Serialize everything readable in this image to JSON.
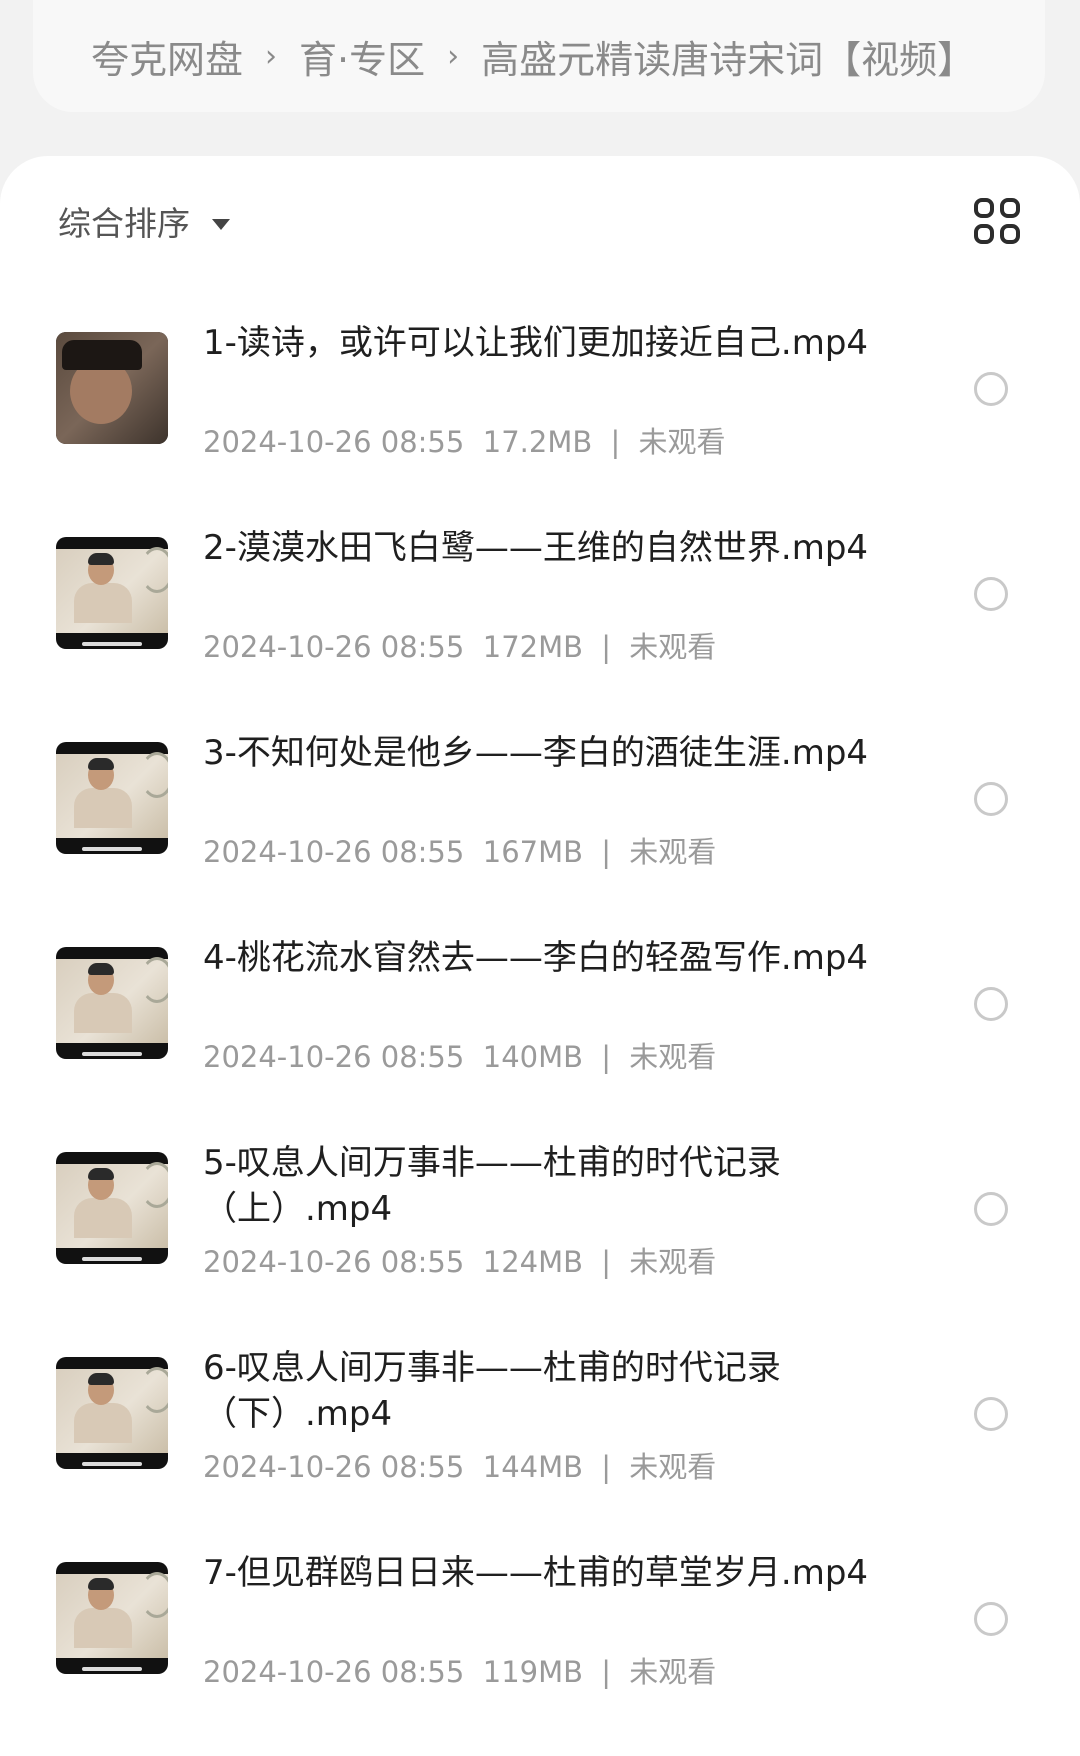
{
  "breadcrumb": {
    "items": [
      "夸克网盘",
      "育·专区",
      "高盛元精读唐诗宋词【视频】"
    ],
    "separator": "›"
  },
  "toolbar": {
    "sort_label": "综合排序",
    "sort_icon": "caret-down-icon",
    "view_icon": "grid-view-icon"
  },
  "files": [
    {
      "name": "1-读诗，或许可以让我们更加接近自己.mp4",
      "date": "2024-10-26 08:55",
      "size": "17.2MB",
      "sep": "|",
      "status": "未观看"
    },
    {
      "name": "2-漠漠水田飞白鹭——王维的自然世界.mp4",
      "date": "2024-10-26 08:55",
      "size": "172MB",
      "sep": "|",
      "status": "未观看"
    },
    {
      "name": "3-不知何处是他乡——李白的酒徒生涯.mp4",
      "date": "2024-10-26 08:55",
      "size": "167MB",
      "sep": "|",
      "status": "未观看"
    },
    {
      "name": "4-桃花流水窅然去——李白的轻盈写作.mp4",
      "date": "2024-10-26 08:55",
      "size": "140MB",
      "sep": "|",
      "status": "未观看"
    },
    {
      "name": "5-叹息人间万事非——杜甫的时代记录（上）.mp4",
      "date": "2024-10-26 08:55",
      "size": "124MB",
      "sep": "|",
      "status": "未观看"
    },
    {
      "name": "6-叹息人间万事非——杜甫的时代记录（下）.mp4",
      "date": "2024-10-26 08:55",
      "size": "144MB",
      "sep": "|",
      "status": "未观看"
    },
    {
      "name": "7-但见群鸥日日来——杜甫的草堂岁月.mp4",
      "date": "2024-10-26 08:55",
      "size": "119MB",
      "sep": "|",
      "status": "未观看"
    }
  ],
  "colors": {
    "background": "#f2f2f2",
    "card": "#ffffff",
    "primary_text": "#1f1f1f",
    "secondary_text": "#9a9a9a"
  }
}
